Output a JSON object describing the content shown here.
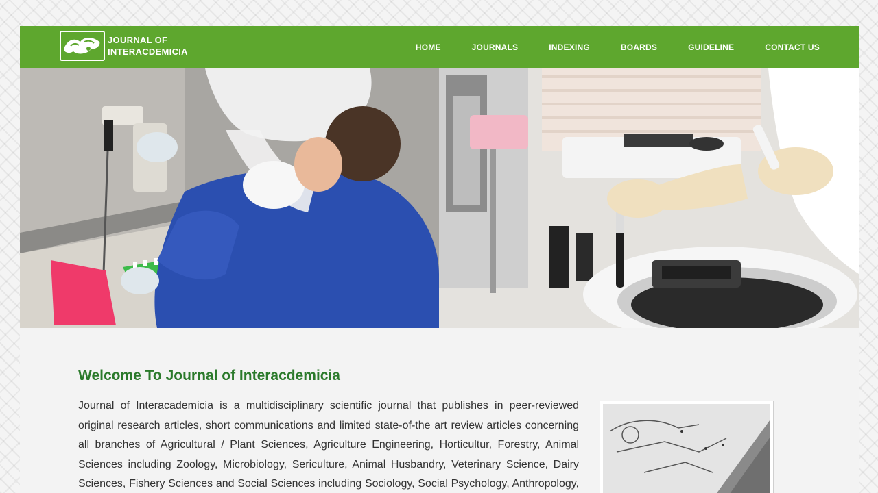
{
  "brand": {
    "line1": "JOURNAL OF",
    "line2": "INTERACDEMICIA"
  },
  "nav": {
    "items": [
      {
        "label": "HOME"
      },
      {
        "label": "JOURNALS"
      },
      {
        "label": "INDEXING"
      },
      {
        "label": "BOARDS"
      },
      {
        "label": "GUIDELINE"
      },
      {
        "label": "CONTACT US"
      }
    ]
  },
  "main": {
    "title": "Welcome To Journal of Interacdemicia",
    "intro": "Journal of Interacademicia is a multidisciplinary scientific journal that publishes in peer-reviewed original research articles, short communications and limited state-of-the art review articles concerning all branches of Agricultural / Plant Sciences, Agriculture Engineering, Horticultur, Forestry, Animal Sciences including Zoology, Microbiology, Sericulture, Animal Husbandry, Veterinary Science, Dairy Sciences, Fishery Sciences and Social Sciences including Sociology, Social Psychology, Anthropology, Economics, Management,"
  },
  "colors": {
    "header_green": "#5ea72e",
    "title_green": "#2b7a2b",
    "text": "#333333"
  }
}
